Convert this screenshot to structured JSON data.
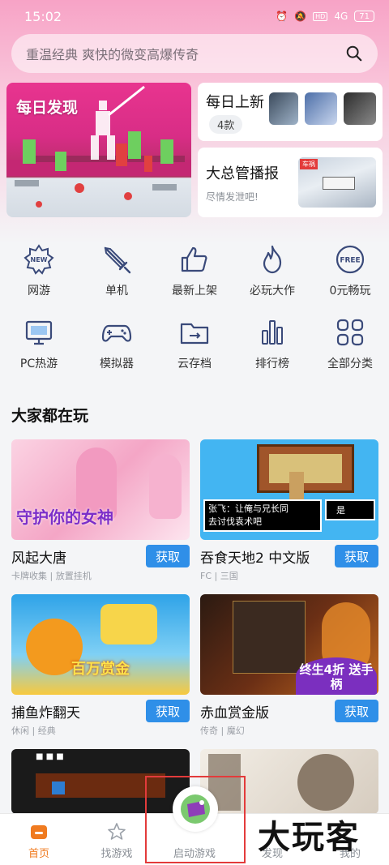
{
  "status_bar": {
    "time": "15:02",
    "signal": "4G",
    "battery": "71"
  },
  "search": {
    "placeholder": "重温经典 爽快的微变高爆传奇"
  },
  "banner_main": {
    "label": "每日发现"
  },
  "daily_new": {
    "title": "每日上新",
    "count": "4款"
  },
  "news": {
    "title": "大总管播报",
    "subtitle": "尽情发泄吧!"
  },
  "categories": [
    {
      "label": "网游",
      "icon": "new-badge-icon"
    },
    {
      "label": "单机",
      "icon": "sword-icon"
    },
    {
      "label": "最新上架",
      "icon": "thumbs-up-icon"
    },
    {
      "label": "必玩大作",
      "icon": "flame-icon"
    },
    {
      "label": "0元畅玩",
      "icon": "free-badge-icon"
    },
    {
      "label": "PC热游",
      "icon": "monitor-icon"
    },
    {
      "label": "模拟器",
      "icon": "gamepad-icon"
    },
    {
      "label": "云存档",
      "icon": "cloud-folder-icon"
    },
    {
      "label": "排行榜",
      "icon": "bar-chart-icon"
    },
    {
      "label": "全部分类",
      "icon": "grid-icon"
    }
  ],
  "section": {
    "title": "大家都在玩"
  },
  "games": [
    {
      "name": "风起大唐",
      "tags": "卡牌收集 | 放置挂机",
      "button": "获取",
      "banner_text": "守护你的女神"
    },
    {
      "name": "吞食天地2 中文版",
      "tags": "FC | 三国",
      "button": "获取",
      "dialog_line1": "张飞：让俺与兄长同",
      "dialog_line2": "去讨伐袁术吧",
      "option": "是"
    },
    {
      "name": "捕鱼炸翻天",
      "tags": "休闲 | 经典",
      "button": "获取",
      "banner_text": "百万赏金"
    },
    {
      "name": "赤血赏金版",
      "tags": "传奇 | 魔幻",
      "button": "获取",
      "banner_text": "终生4折 送手柄"
    },
    {
      "name": "",
      "tags": ""
    },
    {
      "name": "",
      "tags": ""
    }
  ],
  "bottom_nav": {
    "items": [
      {
        "label": "首页",
        "icon": "home-icon"
      },
      {
        "label": "找游戏",
        "icon": "star-icon"
      },
      {
        "label": "启动游戏",
        "icon": "launch-game-icon"
      },
      {
        "label": "发现",
        "icon": "discover-icon"
      },
      {
        "label": "我的",
        "icon": "profile-icon"
      }
    ]
  },
  "watermark": "大玩客",
  "colors": {
    "accent": "#2f8fe8",
    "active_nav": "#f07b20",
    "header_pink": "#f7a3c6",
    "highlight_red": "#e33b3b"
  }
}
